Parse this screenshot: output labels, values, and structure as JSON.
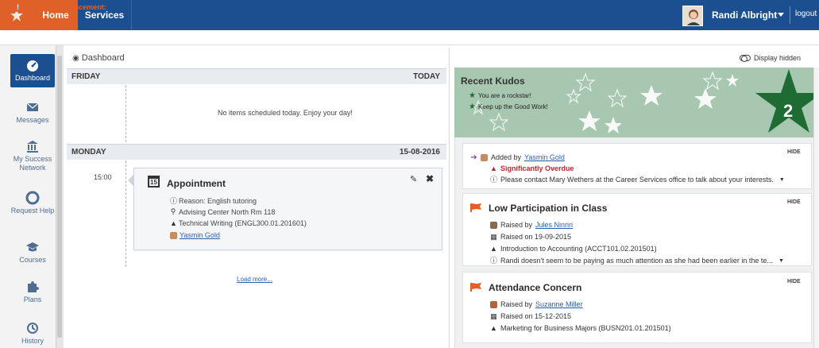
{
  "colors": {
    "brand": "#1b4f8f",
    "accent": "#e0602a",
    "kudos_bg": "#a8c7b0",
    "kudos_star": "#1f6b34",
    "link": "#2a5db0",
    "danger": "#c0262c"
  },
  "topbar": {
    "logo_icon": "star-logo-icon",
    "tabs": [
      {
        "label": "Home"
      },
      {
        "label": "Services"
      }
    ],
    "user_name": "Randi Albright",
    "logout": "logout"
  },
  "announcement": {
    "icon": "info-icon",
    "label": "System Announcement:"
  },
  "sidebar": {
    "items": [
      {
        "label": "Dashboard",
        "icon": "dashboard-icon",
        "active": true
      },
      {
        "label": "Messages",
        "icon": "envelope-icon"
      },
      {
        "label": "My Success Network",
        "icon": "institution-icon"
      },
      {
        "label": "Request Help",
        "icon": "lifebuoy-icon"
      },
      {
        "label": "Courses",
        "icon": "graduation-cap-icon"
      },
      {
        "label": "Plans",
        "icon": "puzzle-icon"
      },
      {
        "label": "History",
        "icon": "history-icon"
      }
    ]
  },
  "dashboard": {
    "title": "Dashboard",
    "friday": {
      "day": "FRIDAY",
      "label": "TODAY",
      "empty": "No items scheduled today. Enjoy your day!"
    },
    "monday": {
      "day": "MONDAY",
      "date": "15-08-2016"
    },
    "appointment": {
      "time": "15:00",
      "calendar_day": "15",
      "title": "Appointment",
      "reason": "Reason: English tutoring",
      "location": "Advising Center North Rm 118",
      "course": "Technical Writing (ENGL300.01.201601)",
      "person": "Yasmin Gold"
    },
    "load_more": "Load more..."
  },
  "right": {
    "display_hidden": "Display hidden",
    "kudos": {
      "title": "Recent Kudos",
      "items": [
        "You are a rockstar!",
        "Keep up the Good Work!"
      ],
      "count": "2"
    },
    "feed": [
      {
        "hide": "HIDE",
        "added_by_prefix": "Added by",
        "added_by": "Yasmin Gold",
        "status": "Significantly Overdue",
        "message": "Please contact Mary Wethers at the Career Services office to talk about your interests."
      },
      {
        "hide": "HIDE",
        "title": "Low Participation in Class",
        "raised_by_prefix": "Raised by",
        "raised_by": "Jules Ninriri",
        "raised_on": "Raised on 19-09-2015",
        "course": "Introduction to Accounting (ACCT101.02.201501)",
        "message": "Randi doesn't seem to be paying as much attention as she had been earlier in the te..."
      },
      {
        "hide": "HIDE",
        "title": "Attendance Concern",
        "raised_by_prefix": "Raised by",
        "raised_by": "Suzanne Miller",
        "raised_on": "Raised on 15-12-2015",
        "course": "Marketing for Business Majors (BUSN201.01.201501)"
      }
    ]
  }
}
